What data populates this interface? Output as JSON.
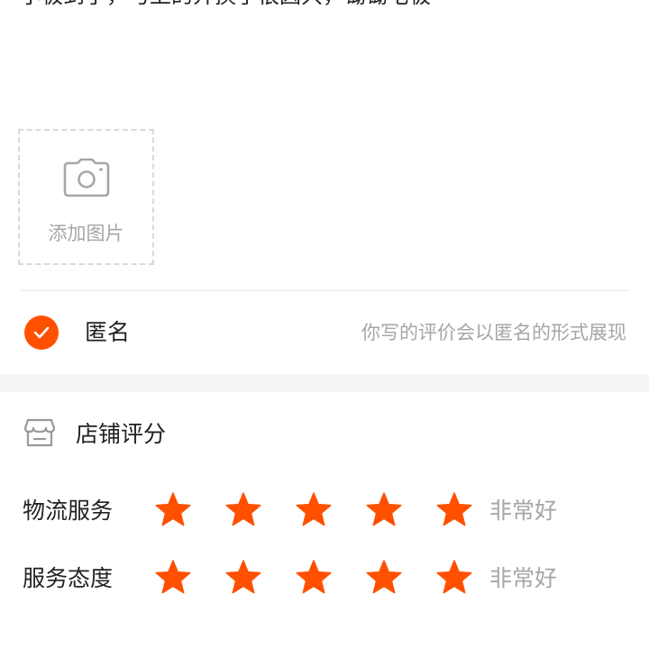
{
  "review": {
    "text": "小极到了，与上的弁换了很因只，锄锄宅极"
  },
  "photo": {
    "add_label": "添加图片",
    "icon": "camera-icon"
  },
  "anonymous": {
    "checked": true,
    "label": "匿名",
    "hint": "你写的评价会以匿名的形式展现",
    "icon": "check-icon"
  },
  "shop_rating": {
    "icon": "store-icon",
    "title": "店铺评分",
    "rows": [
      {
        "label": "物流服务",
        "stars": 5,
        "max_stars": 5,
        "rating_text": "非常好"
      },
      {
        "label": "服务态度",
        "stars": 5,
        "max_stars": 5,
        "rating_text": "非常好"
      }
    ]
  },
  "colors": {
    "accent": "#ff5000",
    "text": "#222222",
    "muted": "#a6a6a6",
    "divider": "#e8e8e8",
    "section_gap": "#f4f4f4"
  }
}
